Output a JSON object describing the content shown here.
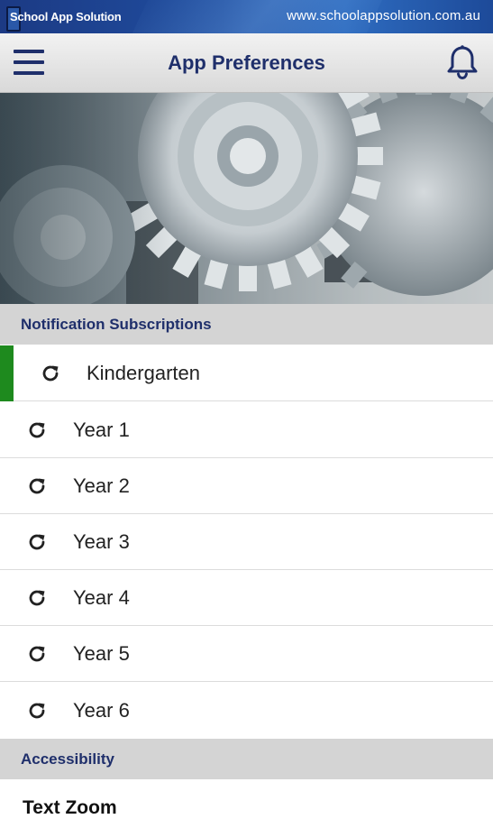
{
  "brand": {
    "name": "School App Solution",
    "url": "www.schoolappsolution.com.au"
  },
  "header": {
    "title": "App Preferences",
    "menu_icon": "hamburger-menu-icon",
    "bell_icon": "bell-icon"
  },
  "hero": {
    "image": "gears-photo"
  },
  "notifications": {
    "heading": "Notification Subscriptions",
    "items": [
      {
        "label": "Kindergarten",
        "icon": "refresh-icon",
        "selected": true
      },
      {
        "label": "Year 1",
        "icon": "refresh-icon"
      },
      {
        "label": "Year 2",
        "icon": "refresh-icon"
      },
      {
        "label": "Year 3",
        "icon": "refresh-icon"
      },
      {
        "label": "Year 4",
        "icon": "refresh-icon"
      },
      {
        "label": "Year 5",
        "icon": "refresh-icon"
      },
      {
        "label": "Year 6",
        "icon": "refresh-icon"
      }
    ]
  },
  "accessibility": {
    "heading": "Accessibility",
    "text_zoom_label": "Text Zoom"
  },
  "colors": {
    "accent_green": "#1e8a1e",
    "title_navy": "#1f2f6b",
    "section_gray": "#d4d4d4"
  }
}
